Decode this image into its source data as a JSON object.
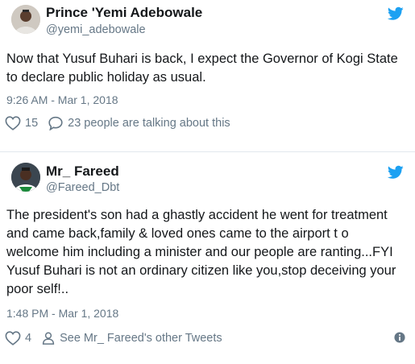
{
  "colors": {
    "twitter_blue": "#1da1f2",
    "secondary_text": "#657786",
    "separator": "#e1e8ed"
  },
  "tweets": [
    {
      "name": "Prince 'Yemi Adebowale",
      "handle": "@yemi_adebowale",
      "text": "Now that Yusuf Buhari is back, I expect the Governor of Kogi State to declare public holiday as usual.",
      "timestamp": "9:26 AM - Mar 1, 2018",
      "likes": "15",
      "secondary_action": "23 people are talking about this",
      "icons": [
        "avatar",
        "twitter-bird-icon",
        "heart-icon",
        "reply-bubble-icon"
      ]
    },
    {
      "name": "Mr_ Fareed",
      "handle": "@Fareed_Dbt",
      "text": "The president's son had a ghastly accident he went for treatment and came back,family & loved ones came to the airport t o welcome him including a minister and our people are ranting...FYI Yusuf Buhari is not an ordinary citizen like you,stop deceiving your poor self!..",
      "timestamp": "1:48 PM - Mar 1, 2018",
      "likes": "4",
      "secondary_action": "See Mr_ Fareed's other Tweets",
      "icons": [
        "avatar",
        "twitter-bird-icon",
        "heart-icon",
        "person-icon",
        "info-icon"
      ]
    }
  ]
}
